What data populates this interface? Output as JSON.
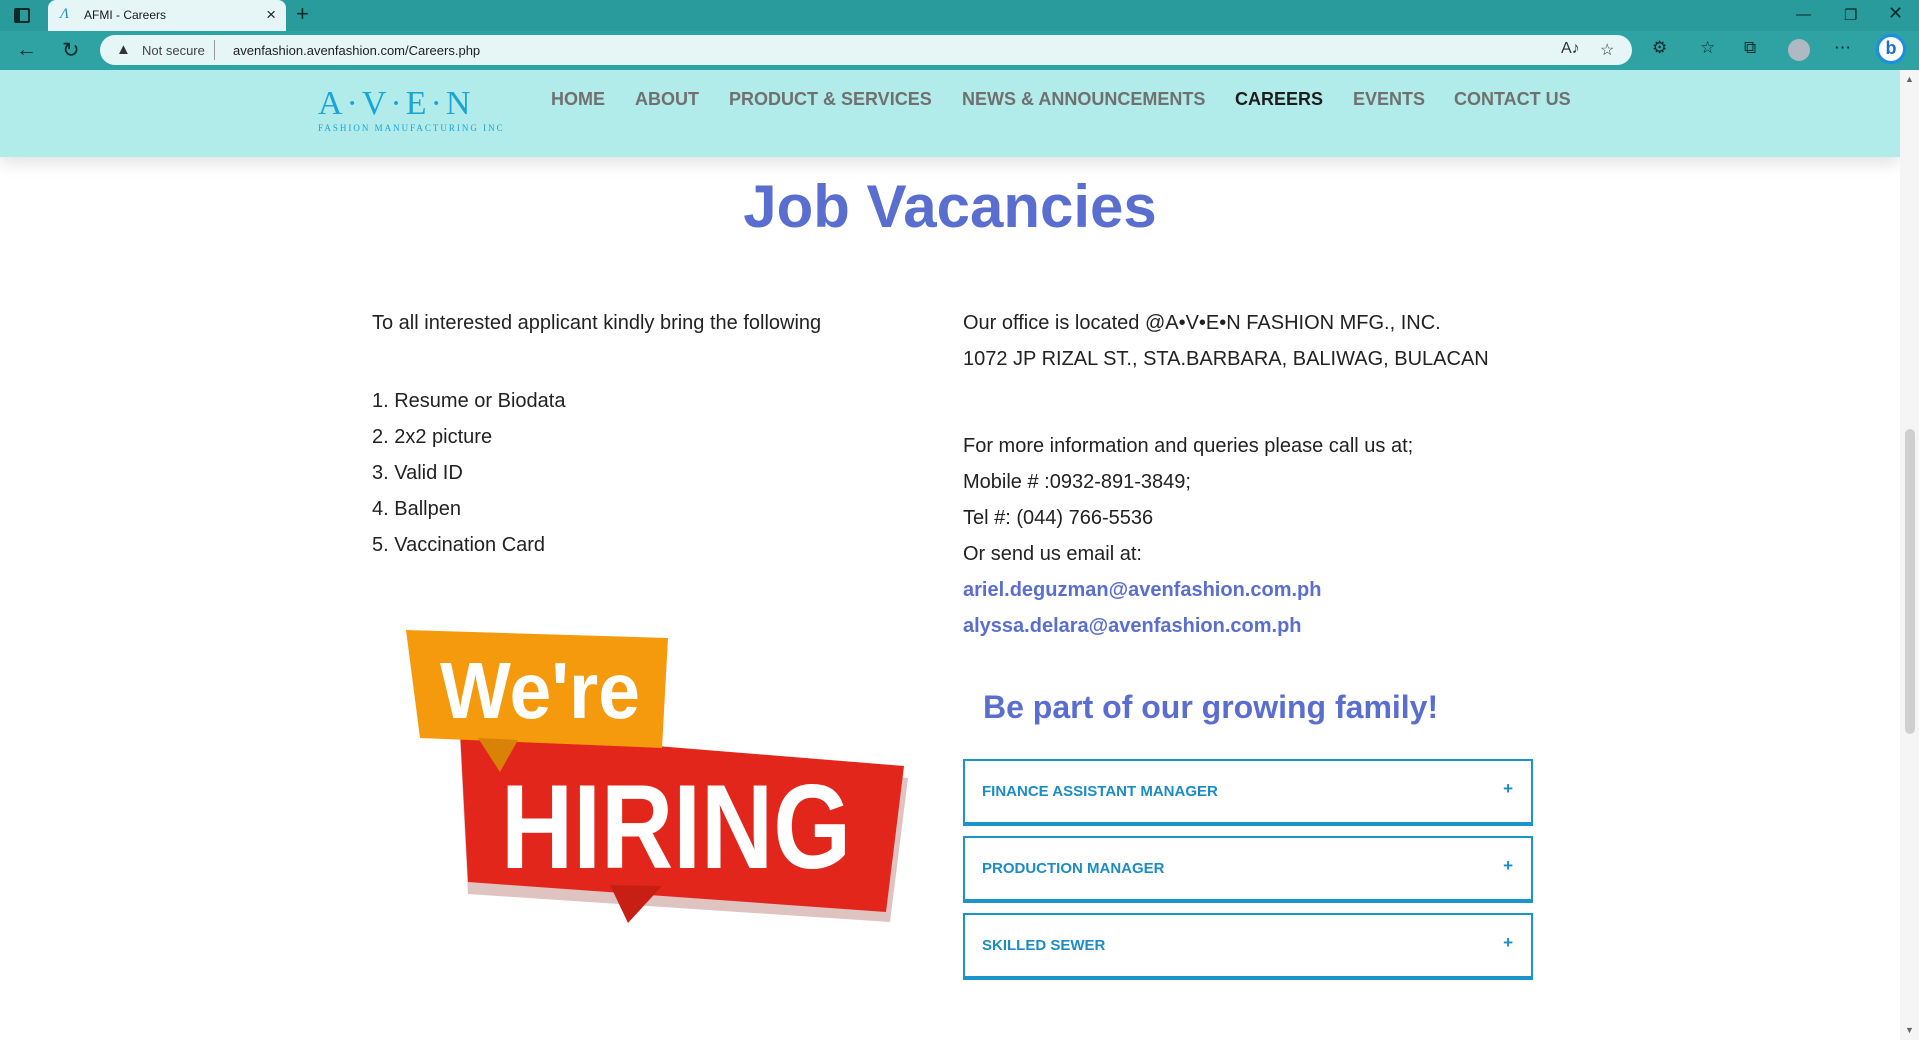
{
  "browser": {
    "tab_title": "AFMI - Careers",
    "not_secure": "Not secure",
    "url": "avenfashion.avenfashion.com/Careers.php"
  },
  "site": {
    "logo_main": "A·V·E·N",
    "logo_sub": "FASHION MANUFACTURING INC",
    "nav": [
      "HOME",
      "ABOUT",
      "PRODUCT & SERVICES",
      "NEWS & ANNOUNCEMENTS",
      "CAREERS",
      "EVENTS",
      "CONTACT US"
    ],
    "active_nav": "CAREERS"
  },
  "main": {
    "title": "Job Vacancies",
    "intro": "To all interested applicant kindly bring the following",
    "requirements": [
      "1. Resume or Biodata",
      "2. 2x2 picture",
      "3. Valid ID",
      "4. Ballpen",
      "5. Vaccination Card"
    ],
    "office_line1": "Our office is located @A•V•E•N FASHION MFG., INC.",
    "office_line2": "1072 JP RIZAL ST., STA.BARBARA, BALIWAG, BULACAN",
    "info_line": "For more information and queries please call us at;",
    "mobile": "Mobile # :0932-891-3849;",
    "tel": "Tel #: (044) 766-5536",
    "email_intro": "Or send us email at:",
    "emails": [
      "ariel.deguzman@avenfashion.com.ph",
      "alyssa.delara@avenfashion.com.ph"
    ],
    "hiring_top": "We're",
    "hiring_bottom": "HIRING",
    "tagline": "Be part of our growing family!",
    "jobs": [
      "FINANCE ASSISTANT MANAGER",
      "PRODUCTION MANAGER",
      "SKILLED SEWER"
    ],
    "expand_symbol": "+"
  },
  "colors": {
    "browser_frame": "#2fa3a4",
    "navbar": "#b1ebea",
    "accent_blue": "#5a6ed0",
    "accordion_blue": "#1b8cc4",
    "hiring_orange": "#f59a0c",
    "hiring_red": "#e3261b"
  }
}
